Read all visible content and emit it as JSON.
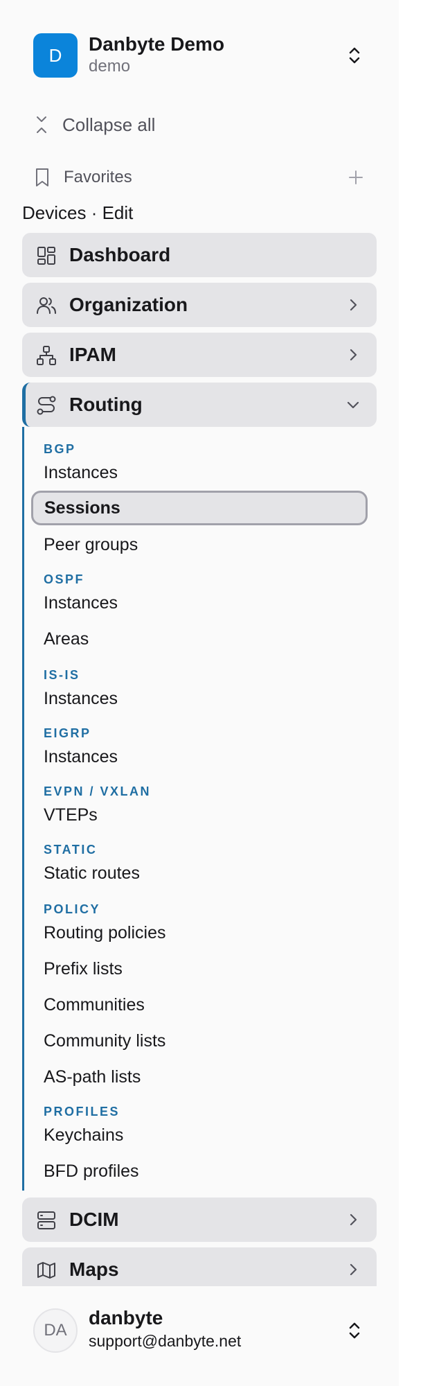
{
  "org": {
    "initial": "D",
    "name": "Danbyte Demo",
    "slug": "demo"
  },
  "collapse_label": "Collapse all",
  "favorites_label": "Favorites",
  "breadcrumb": "Devices · Edit",
  "nav": {
    "dashboard": "Dashboard",
    "organization": "Organization",
    "ipam": "IPAM",
    "routing": "Routing",
    "dcim": "DCIM",
    "maps": "Maps"
  },
  "routing": {
    "bgp": {
      "title": "BGP",
      "items": [
        "Instances",
        "Sessions",
        "Peer groups"
      ]
    },
    "ospf": {
      "title": "OSPF",
      "items": [
        "Instances",
        "Areas"
      ]
    },
    "isis": {
      "title": "IS-IS",
      "items": [
        "Instances"
      ]
    },
    "eigrp": {
      "title": "EIGRP",
      "items": [
        "Instances"
      ]
    },
    "evpn": {
      "title": "EVPN / VXLAN",
      "items": [
        "VTEPs"
      ]
    },
    "static": {
      "title": "STATIC",
      "items": [
        "Static routes"
      ]
    },
    "policy": {
      "title": "POLICY",
      "items": [
        "Routing policies",
        "Prefix lists",
        "Communities",
        "Community lists",
        "AS-path lists"
      ]
    },
    "profiles": {
      "title": "PROFILES",
      "items": [
        "Keychains",
        "BFD profiles"
      ]
    }
  },
  "user": {
    "initials": "DA",
    "name": "danbyte",
    "email": "support@danbyte.net"
  },
  "colors": {
    "accent": "#1f6ea3",
    "org_avatar": "#0b84da",
    "nav_bg": "#e4e4e7"
  }
}
